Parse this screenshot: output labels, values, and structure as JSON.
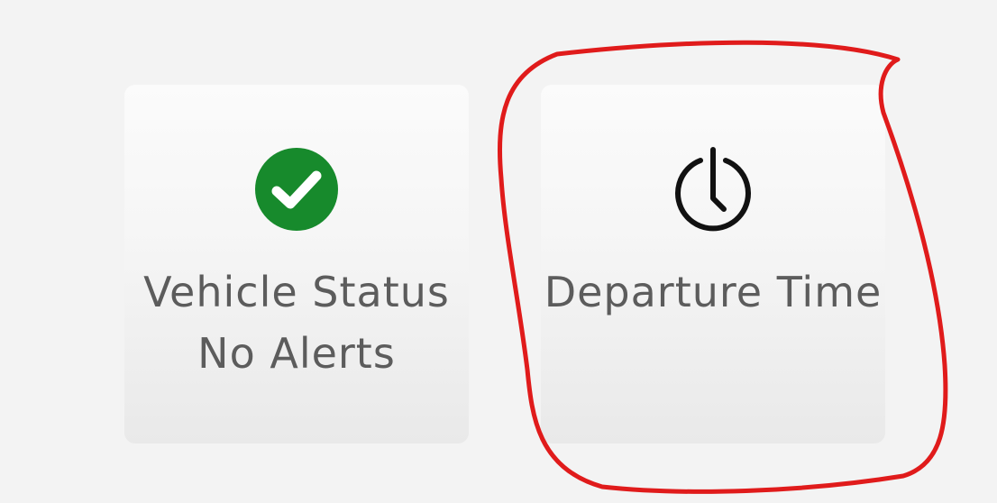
{
  "tiles": [
    {
      "title": "Vehicle Status",
      "subtitle": "No Alerts",
      "icon": "check-circle-icon",
      "icon_color": "#178a2c"
    },
    {
      "title": "Departure Time",
      "subtitle": "",
      "icon": "clock-power-icon",
      "icon_color": "#111111"
    }
  ],
  "annotation": {
    "type": "hand-drawn-circle",
    "color": "#e01b1b"
  }
}
